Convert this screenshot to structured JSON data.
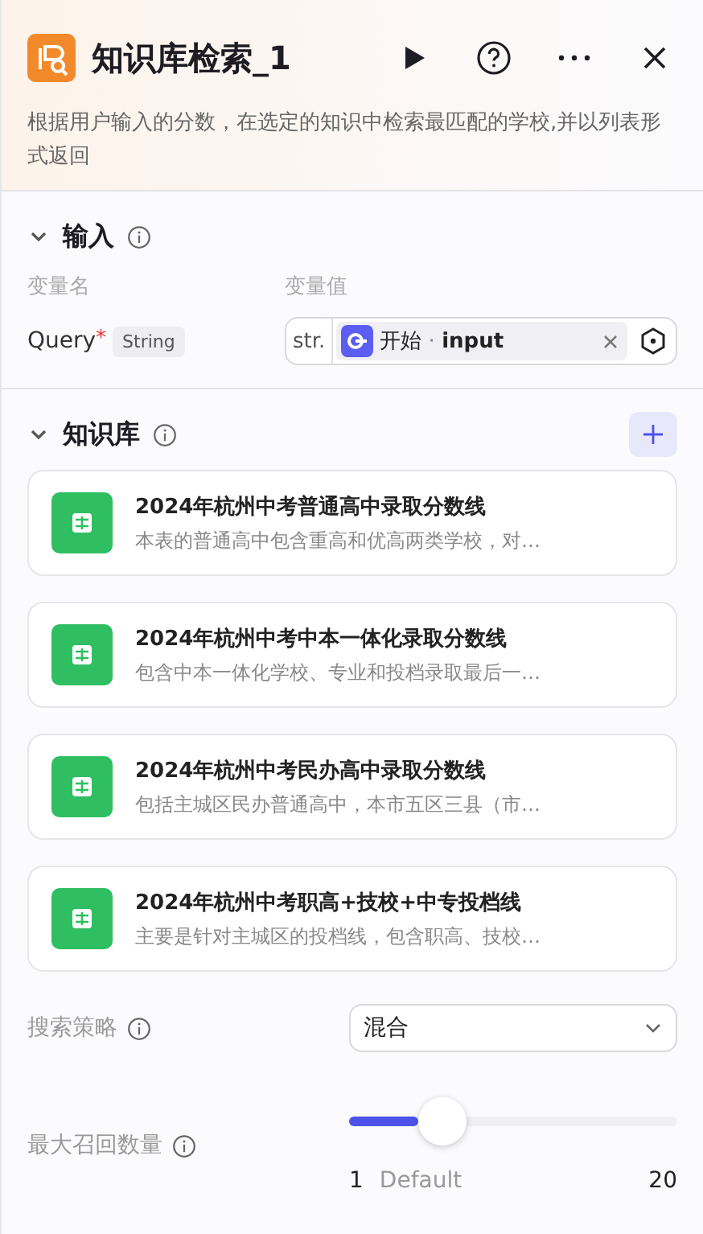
{
  "header": {
    "title": "知识库检索_1",
    "description": "根据用户输入的分数，在选定的知识中检索最匹配的学校,并以列表形式返回"
  },
  "input_section": {
    "title": "输入",
    "expanded": true,
    "columns": [
      "变量名",
      "变量值"
    ],
    "params": [
      {
        "name": "Query",
        "required_mark": "*",
        "type": "String",
        "value_prefix": "str.",
        "source": "开始",
        "separator": "·",
        "field": "input"
      }
    ]
  },
  "knowledge_section": {
    "title": "知识库",
    "expanded": true,
    "items": [
      {
        "title": "2024年杭州中考普通高中录取分数线",
        "description": "本表的普通高中包含重高和优高两类学校，对…"
      },
      {
        "title": "2024年杭州中考中本一体化录取分数线",
        "description": "包含中本一体化学校、专业和投档录取最后一…"
      },
      {
        "title": "2024年杭州中考民办高中录取分数线",
        "description": "包括主城区民办普通高中，本市五区三县（市…"
      },
      {
        "title": "2024年杭州中考职高+技校+中专投档线",
        "description": "主要是针对主城区的投档线，包含职高、技校…"
      }
    ]
  },
  "settings": [
    {
      "kind": "select",
      "label": "搜索策略",
      "value": "混合"
    },
    {
      "kind": "slider",
      "label": "最大召回数量",
      "level": 0.21,
      "min": "1",
      "mid": "Default",
      "max": "20"
    }
  ]
}
